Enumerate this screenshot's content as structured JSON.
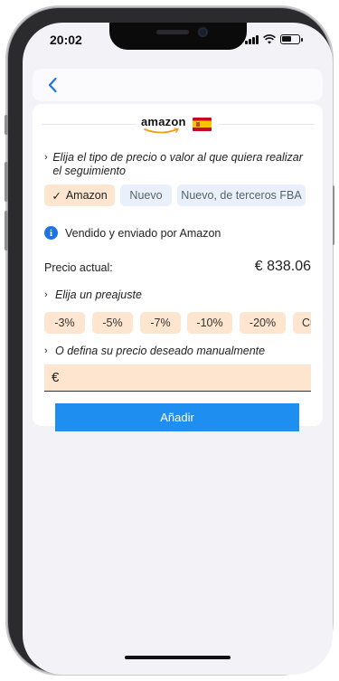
{
  "status_bar": {
    "time": "20:02",
    "icons": [
      "signal-icon",
      "wifi-icon",
      "battery-icon"
    ]
  },
  "nav": {
    "back_icon": "chevron-left-icon",
    "accent": "#1a73e8"
  },
  "marketplace": {
    "brand": "amazon",
    "flag_icon": "spain-flag-icon"
  },
  "price_type": {
    "prompt": "Elija el tipo de precio o valor al que quiera realizar el seguimiento",
    "options": [
      {
        "label": "Amazon",
        "selected": true,
        "check": "✓"
      },
      {
        "label": "Nuevo",
        "selected": false
      },
      {
        "label": "Nuevo, de terceros FBA",
        "selected": false
      }
    ]
  },
  "info": {
    "icon": "info-icon",
    "text": "Vendido y enviado por Amazon"
  },
  "current_price": {
    "label": "Precio actual:",
    "value": "€ 838.06"
  },
  "presets": {
    "prompt": "Elija un preajuste",
    "items": [
      "-3%",
      "-5%",
      "-7%",
      "-10%",
      "-20%",
      "Cu"
    ]
  },
  "manual": {
    "prompt": "O defina su precio deseado manualmente",
    "currency": "€",
    "value": "",
    "placeholder": ""
  },
  "add_button": {
    "label": "Añadir",
    "color": "#1e8ff0"
  },
  "colors": {
    "chip_selected": "#fde5cf",
    "chip_unselected": "#e9effb",
    "background": "#f2f2f7"
  }
}
